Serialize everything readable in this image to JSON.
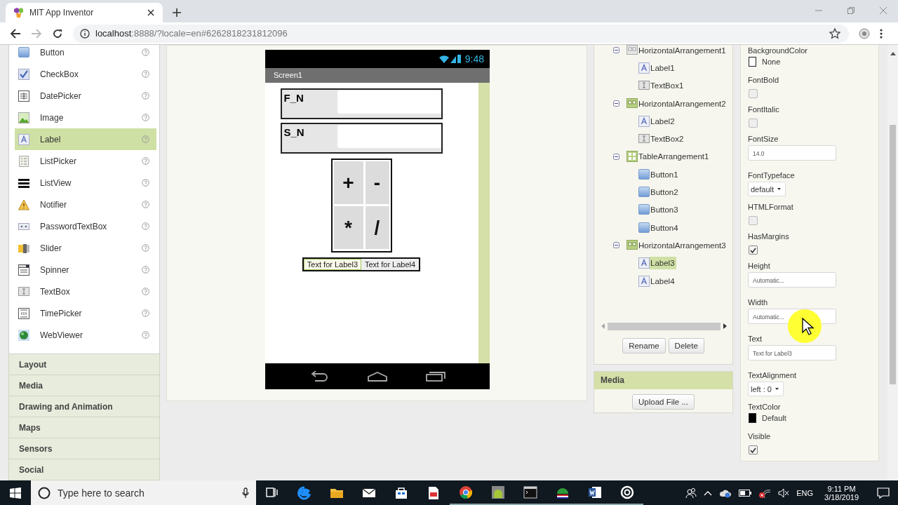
{
  "browser": {
    "tab_title": "MIT App Inventor",
    "address": {
      "host": "localhost",
      "path": ":8888/?locale=en#6262818231812096"
    }
  },
  "palette": {
    "items": [
      {
        "kind": "button",
        "label": "Button",
        "selected": false
      },
      {
        "kind": "checkbox",
        "label": "CheckBox",
        "selected": false
      },
      {
        "kind": "datepicker",
        "label": "DatePicker",
        "selected": false
      },
      {
        "kind": "image",
        "label": "Image",
        "selected": false
      },
      {
        "kind": "label",
        "label": "Label",
        "selected": true
      },
      {
        "kind": "listpicker",
        "label": "ListPicker",
        "selected": false
      },
      {
        "kind": "listview",
        "label": "ListView",
        "selected": false
      },
      {
        "kind": "notifier",
        "label": "Notifier",
        "selected": false
      },
      {
        "kind": "password",
        "label": "PasswordTextBox",
        "selected": false
      },
      {
        "kind": "slider",
        "label": "Slider",
        "selected": false
      },
      {
        "kind": "spinner",
        "label": "Spinner",
        "selected": false
      },
      {
        "kind": "textbox",
        "label": "TextBox",
        "selected": false
      },
      {
        "kind": "timepicker",
        "label": "TimePicker",
        "selected": false
      },
      {
        "kind": "webviewer",
        "label": "WebViewer",
        "selected": false
      }
    ],
    "drawers": [
      "Layout",
      "Media",
      "Drawing and Animation",
      "Maps",
      "Sensors",
      "Social"
    ]
  },
  "phone": {
    "time": "9:48",
    "screen_title": "Screen1",
    "rows": [
      {
        "label": "F_N"
      },
      {
        "label": "S_N"
      }
    ],
    "buttons": [
      "+",
      "-",
      "*",
      "/"
    ],
    "labels": [
      {
        "text": "Text for Label3",
        "selected": true
      },
      {
        "text": "Text for Label4",
        "selected": false
      }
    ]
  },
  "components": {
    "tree": [
      {
        "kind": "hbox",
        "label": "HorizontalArrangement1",
        "expanded": true,
        "selected": false,
        "children": [
          {
            "kind": "label",
            "label": "Label1",
            "selected": false
          },
          {
            "kind": "textbox",
            "label": "TextBox1",
            "selected": false
          }
        ]
      },
      {
        "kind": "hbox-green",
        "label": "HorizontalArrangement2",
        "expanded": true,
        "selected": false,
        "children": [
          {
            "kind": "label",
            "label": "Label2",
            "selected": false
          },
          {
            "kind": "textbox",
            "label": "TextBox2",
            "selected": false
          }
        ]
      },
      {
        "kind": "table",
        "label": "TableArrangement1",
        "expanded": true,
        "selected": false,
        "children": [
          {
            "kind": "button",
            "label": "Button1",
            "selected": false
          },
          {
            "kind": "button",
            "label": "Button2",
            "selected": false
          },
          {
            "kind": "button",
            "label": "Button3",
            "selected": false
          },
          {
            "kind": "button",
            "label": "Button4",
            "selected": false
          }
        ]
      },
      {
        "kind": "hbox-green",
        "label": "HorizontalArrangement3",
        "expanded": true,
        "selected": false,
        "children": [
          {
            "kind": "label",
            "label": "Label3",
            "selected": true
          },
          {
            "kind": "label",
            "label": "Label4",
            "selected": false
          }
        ]
      }
    ],
    "buttons": [
      "Rename",
      "Delete"
    ],
    "media": {
      "title": "Media",
      "upload": "Upload File ..."
    }
  },
  "properties": [
    {
      "kind": "color",
      "name": "BackgroundColor",
      "color": "#ffffff",
      "value": "None"
    },
    {
      "kind": "checkbox",
      "name": "FontBold",
      "checked": false
    },
    {
      "kind": "checkbox",
      "name": "FontItalic",
      "checked": false
    },
    {
      "kind": "text",
      "name": "FontSize",
      "value": "14.0"
    },
    {
      "kind": "dropdown",
      "name": "FontTypeface",
      "value": "default"
    },
    {
      "kind": "checkbox",
      "name": "HTMLFormat",
      "checked": false
    },
    {
      "kind": "checkbox",
      "name": "HasMargins",
      "checked": true
    },
    {
      "kind": "text",
      "name": "Height",
      "value": "Automatic..."
    },
    {
      "kind": "text",
      "name": "Width",
      "value": "Automatic..."
    },
    {
      "kind": "text",
      "name": "Text",
      "value": "Text for Label3"
    },
    {
      "kind": "dropdown",
      "name": "TextAlignment",
      "value": "left : 0"
    },
    {
      "kind": "color",
      "name": "TextColor",
      "color": "#000000",
      "value": "Default"
    },
    {
      "kind": "checkbox",
      "name": "Visible",
      "checked": true
    }
  ],
  "taskbar": {
    "search_placeholder": "Type here to search",
    "language": "ENG",
    "time": "9:11 PM",
    "date": "3/18/2019"
  }
}
